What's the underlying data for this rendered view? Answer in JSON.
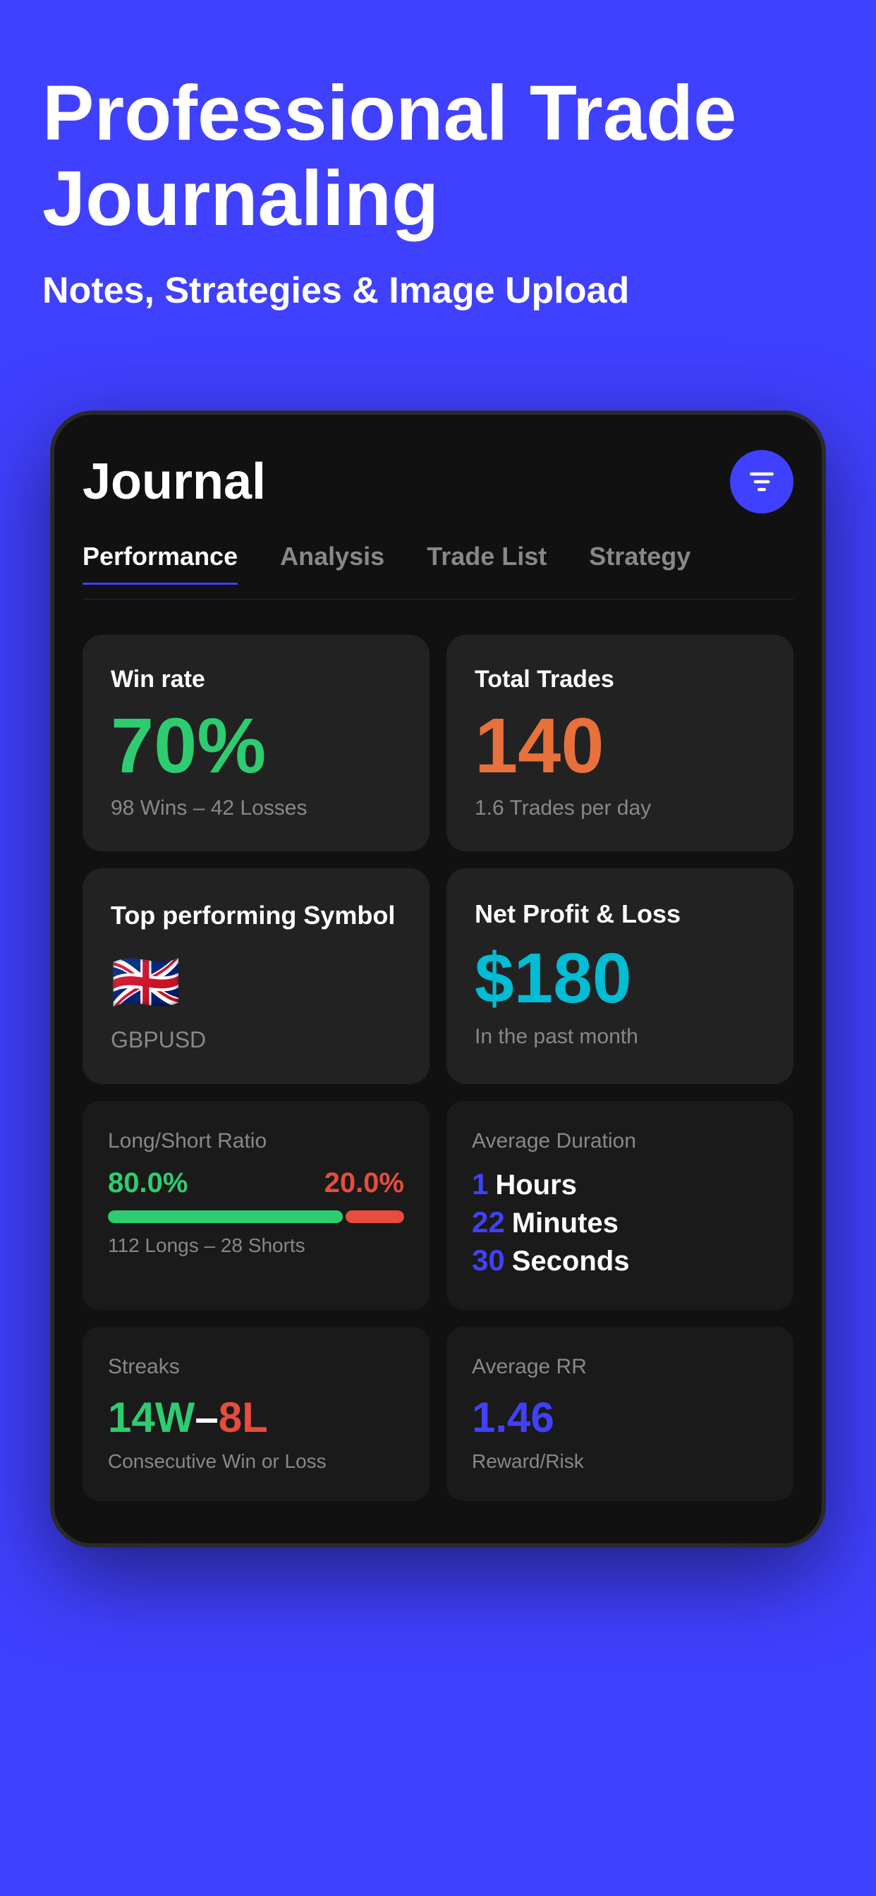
{
  "hero": {
    "title": "Professional Trade Journaling",
    "subtitle": "Notes, Strategies & Image Upload"
  },
  "phone": {
    "header": {
      "title": "Journal",
      "filter_icon": "filter-icon"
    },
    "tabs": [
      {
        "label": "Performance",
        "active": true
      },
      {
        "label": "Analysis",
        "active": false
      },
      {
        "label": "Trade List",
        "active": false
      },
      {
        "label": "Strategy",
        "active": false
      }
    ],
    "win_rate": {
      "label": "Win rate",
      "value": "70%",
      "description": "98 Wins – 42 Losses"
    },
    "total_trades": {
      "label": "Total Trades",
      "value": "140",
      "description": "1.6 Trades per day"
    },
    "top_symbol": {
      "label": "Top performing Symbol",
      "flag": "🇬🇧",
      "symbol": "GBPUSD"
    },
    "net_pnl": {
      "label": "Net Profit & Loss",
      "value": "$180",
      "description": "In the past month"
    },
    "long_short": {
      "label": "Long/Short Ratio",
      "long_pct": "80.0%",
      "short_pct": "20.0%",
      "description": "112 Longs – 28 Shorts",
      "long_ratio": 80,
      "short_ratio": 20
    },
    "avg_duration": {
      "label": "Average Duration",
      "hours": "1",
      "hours_unit": "Hours",
      "minutes": "22",
      "minutes_unit": "Minutes",
      "seconds": "30",
      "seconds_unit": "Seconds"
    },
    "streaks": {
      "label": "Streaks",
      "wins": "14W",
      "dash": "–",
      "losses": "8L",
      "description": "Consecutive Win or Loss"
    },
    "avg_rr": {
      "label": "Average RR",
      "value": "1.46",
      "description": "Reward/Risk"
    }
  }
}
